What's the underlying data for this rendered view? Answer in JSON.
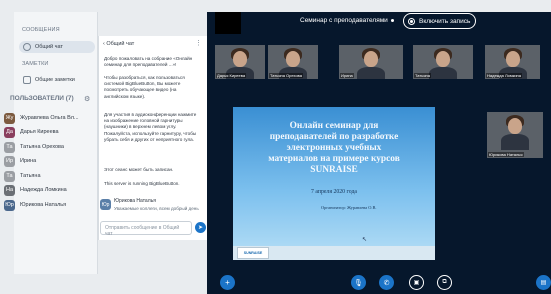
{
  "sidebar": {
    "messages_header": "СООБЩЕНИЯ",
    "public_chat_label": "Общий чат",
    "notes_header": "ЗАМЕТКИ",
    "shared_notes_label": "Общие заметки",
    "users_header": "ПОЛЬЗОВАТЕЛИ (7)",
    "users": [
      {
        "initials": "Жу",
        "name": "Журавлева Ольга Вл...",
        "color": "#7c5a3f"
      },
      {
        "initials": "Да",
        "name": "Дарья Киреева",
        "color": "#8a3f5e"
      },
      {
        "initials": "Та",
        "name": "Татьяна Орехова",
        "color": "#9b9ea3"
      },
      {
        "initials": "Ир",
        "name": "Ирина",
        "color": "#9b9ea3"
      },
      {
        "initials": "Та",
        "name": "Татьяна",
        "color": "#9b9ea3"
      },
      {
        "initials": "На",
        "name": "Надежда Ломкина",
        "color": "#6b6f75"
      },
      {
        "initials": "Юр",
        "name": "Юрикова Наталья",
        "color": "#4a678c"
      }
    ]
  },
  "chat": {
    "header": "Общий чат",
    "welcome": "Добро пожаловать на собрание «Онлайн семинар для преподавателей ...»!",
    "help": "Чтобы разобраться, как пользоваться системой BigBlueButton, Вы можете посмотреть обучающее видео (на английском языке).",
    "audio": "Для участия в аудиоконференции нажмите на изображение головной гарнитуры (наушники) в верхнем левом углу. Пожалуйста, используйте гарнитуру, чтобы убрать себя и других от неприятного гула.",
    "recording": "Этот сеанс может быть записан.",
    "server": "This server is running BigBlueButton.",
    "last_author": "Юрикова Наталья",
    "last_author_initials": "Юр",
    "last_text": "Уважаемые коллеги, всем добрый день",
    "input_placeholder": "Отправить сообщение в Общий чат"
  },
  "topbar": {
    "title": "Семинар с преподавателями",
    "record_label": "Включить запись"
  },
  "videos": [
    {
      "name": "Дарья Киреева"
    },
    {
      "name": "Татьяна Орехова"
    },
    {
      "name": "Ирина"
    },
    {
      "name": "Татьяна"
    },
    {
      "name": "Надежда Ломкина"
    },
    {
      "name": "Юрикова Наталья"
    }
  ],
  "slide": {
    "title": "Онлайн семинар для преподавателей по разработке электронных учебных материалов на примере курсов SUNRAISE",
    "date": "7 апреля 2020 года",
    "organizer": "Организатор: Журавлева О.В.",
    "logo_text": "SUNRAISE"
  },
  "controls": {
    "plus_icon": "plus-icon",
    "mic_icon": "microphone-icon",
    "phone_icon": "phone-icon",
    "video_icon": "video-camera-icon",
    "screen_icon": "screen-share-icon"
  }
}
